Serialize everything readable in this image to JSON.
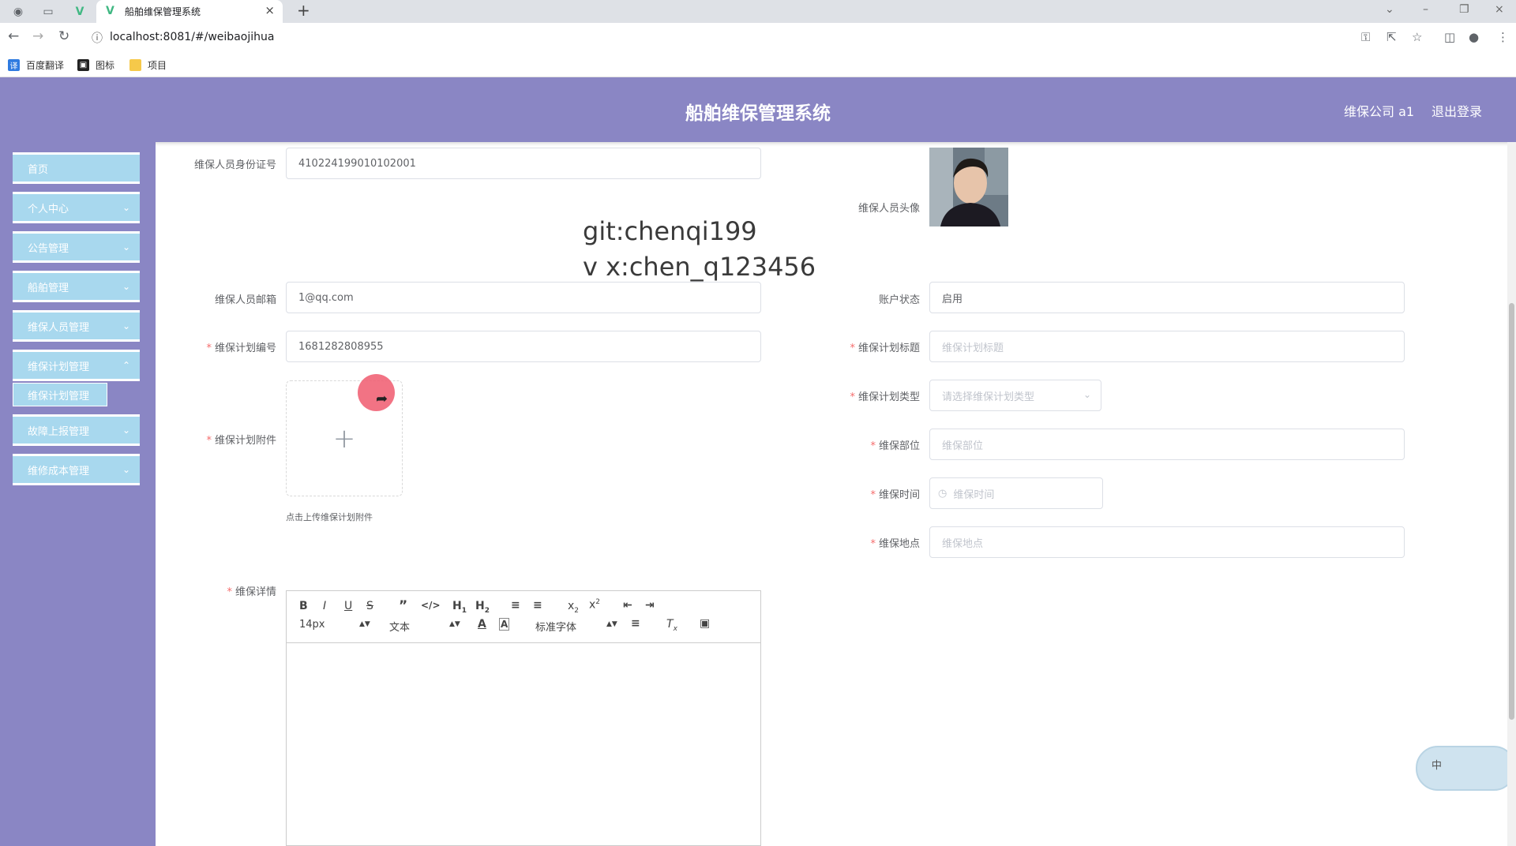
{
  "browser": {
    "tab_title": "船舶维保管理系统",
    "url": "localhost:8081/#/weibaojihua",
    "bookmarks": [
      "百度翻译",
      "图标",
      "项目"
    ]
  },
  "header": {
    "title": "船舶维保管理系统",
    "user": "维保公司 a1",
    "logout": "退出登录"
  },
  "sidebar": {
    "items": [
      {
        "label": "首页"
      },
      {
        "label": "个人中心"
      },
      {
        "label": "公告管理"
      },
      {
        "label": "船舶管理"
      },
      {
        "label": "维保人员管理"
      },
      {
        "label": "维保计划管理"
      },
      {
        "label": "故障上报管理"
      },
      {
        "label": "维修成本管理"
      }
    ],
    "submenu": {
      "label": "维保计划管理"
    }
  },
  "form": {
    "id_card": {
      "label": "维保人员身份证号",
      "value": "410224199010102001"
    },
    "avatar": {
      "label": "维保人员头像"
    },
    "email": {
      "label": "维保人员邮箱",
      "value": "1@qq.com"
    },
    "account_status": {
      "label": "账户状态",
      "value": "启用"
    },
    "plan_no": {
      "label": "维保计划编号",
      "value": "1681282808955"
    },
    "plan_title": {
      "label": "维保计划标题",
      "placeholder": "维保计划标题"
    },
    "plan_type": {
      "label": "维保计划类型",
      "placeholder": "请选择维保计划类型"
    },
    "attachment": {
      "label": "维保计划附件",
      "tip": "点击上传维保计划附件"
    },
    "part": {
      "label": "维保部位",
      "placeholder": "维保部位"
    },
    "time": {
      "label": "维保时间",
      "placeholder": "维保时间"
    },
    "location": {
      "label": "维保地点",
      "placeholder": "维保地点"
    },
    "details": {
      "label": "维保详情"
    }
  },
  "watermark": {
    "line1": "git:chenqi199",
    "line2": "v x:chen_q123456"
  },
  "editor": {
    "font_size": "14px",
    "header_select": "文本",
    "font_family": "标准字体"
  },
  "widget": {
    "label": "中"
  }
}
